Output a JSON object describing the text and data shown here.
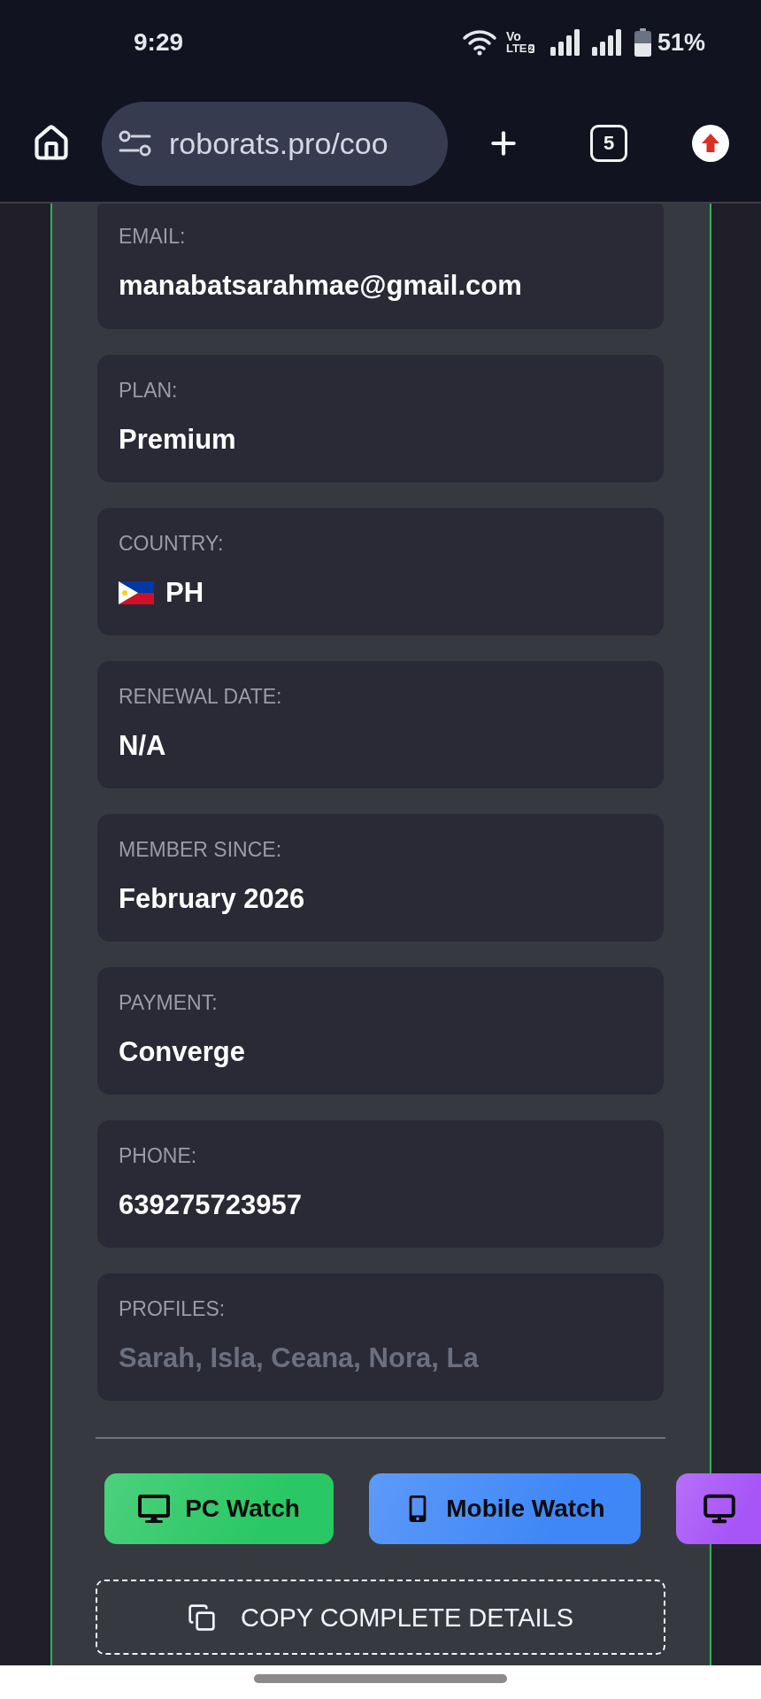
{
  "status_bar": {
    "time": "9:29",
    "network_top": "Vo",
    "network_bottom": "LTE",
    "sim_slot": "2",
    "battery": "51%"
  },
  "browser": {
    "url": "roborats.pro/coo",
    "tab_count": "5"
  },
  "fields": [
    {
      "kind": "text",
      "label": "EMAIL:",
      "value": "manabatsarahmae@gmail.com"
    },
    {
      "kind": "text",
      "label": "PLAN:",
      "value": "Premium"
    },
    {
      "kind": "flag",
      "label": "COUNTRY:",
      "value": "PH"
    },
    {
      "kind": "text",
      "label": "RENEWAL DATE:",
      "value": "N/A"
    },
    {
      "kind": "text",
      "label": "MEMBER SINCE:",
      "value": "February 2026"
    },
    {
      "kind": "text",
      "label": "PAYMENT:",
      "value": "Converge"
    },
    {
      "kind": "text",
      "label": "PHONE:",
      "value": "639275723957"
    },
    {
      "kind": "faded",
      "label": "PROFILES:",
      "value": "Sarah, Isla, Ceana, Nora, La"
    }
  ],
  "watch_buttons": [
    {
      "kind": "desktop",
      "label": "PC Watch",
      "color": "#2ac864"
    },
    {
      "kind": "phone",
      "label": "Mobile Watch",
      "color": "#3f87f7"
    },
    {
      "kind": "monitor",
      "color": "#a855f7"
    }
  ],
  "copy_button": {
    "label": "COPY COMPLETE DETAILS"
  }
}
